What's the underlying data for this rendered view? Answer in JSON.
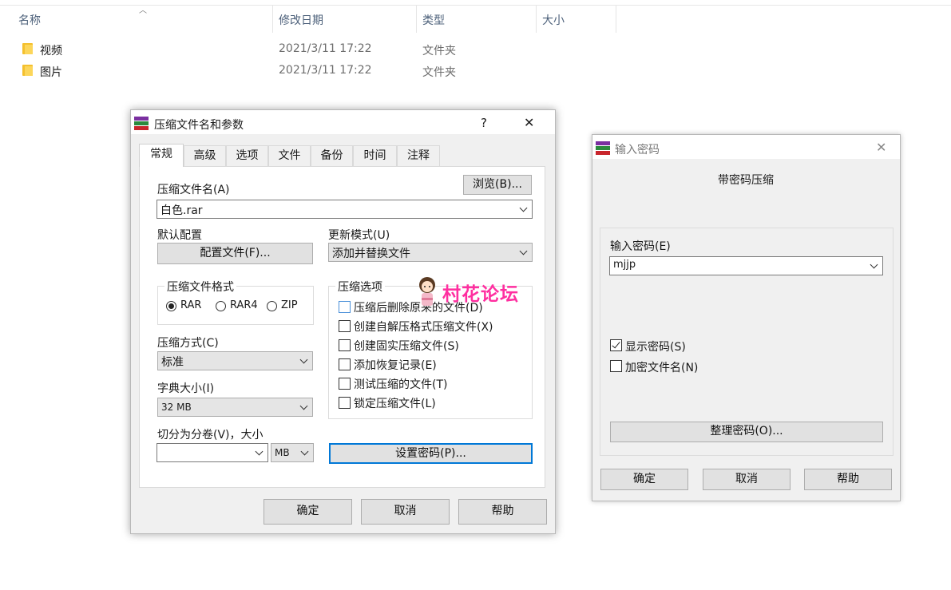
{
  "explorer": {
    "columns": {
      "name": "名称",
      "modified": "修改日期",
      "type": "类型",
      "size": "大小"
    },
    "rows": [
      {
        "name": "视频",
        "modified": "2021/3/11 17:22",
        "type": "文件夹"
      },
      {
        "name": "图片",
        "modified": "2021/3/11 17:22",
        "type": "文件夹"
      }
    ]
  },
  "archive_dialog": {
    "title": "压缩文件名和参数",
    "help_glyph": "?",
    "close_glyph": "✕",
    "tabs": [
      "常规",
      "高级",
      "选项",
      "文件",
      "备份",
      "时间",
      "注释"
    ],
    "archive_name_label": "压缩文件名(A)",
    "browse_button": "浏览(B)...",
    "archive_name_value": "白色.rar",
    "default_profile_label": "默认配置",
    "profiles_button": "配置文件(F)...",
    "update_mode_label": "更新模式(U)",
    "update_mode_value": "添加并替换文件",
    "format_group": "压缩文件格式",
    "formats": [
      "RAR",
      "RAR4",
      "ZIP"
    ],
    "selected_format": "RAR",
    "method_label": "压缩方式(C)",
    "method_value": "标准",
    "dict_label": "字典大小(I)",
    "dict_value": "32 MB",
    "split_label": "切分为分卷(V)，大小",
    "split_value": "",
    "split_unit": "MB",
    "options_group": "压缩选项",
    "options": [
      {
        "label": "压缩后删除原来的文件(D)",
        "checked": false
      },
      {
        "label": "创建自解压格式压缩文件(X)",
        "checked": false
      },
      {
        "label": "创建固实压缩文件(S)",
        "checked": false
      },
      {
        "label": "添加恢复记录(E)",
        "checked": false
      },
      {
        "label": "测试压缩的文件(T)",
        "checked": false
      },
      {
        "label": "锁定压缩文件(L)",
        "checked": false
      }
    ],
    "set_password_button": "设置密码(P)...",
    "ok_button": "确定",
    "cancel_button": "取消",
    "help_button": "帮助"
  },
  "watermark": {
    "text": "村花论坛"
  },
  "password_dialog": {
    "title": "输入密码",
    "close_glyph": "✕",
    "heading": "带密码压缩",
    "password_label": "输入密码(E)",
    "password_value": "mjjp",
    "show_password": {
      "label": "显示密码(S)",
      "checked": true
    },
    "encrypt_names": {
      "label": "加密文件名(N)",
      "checked": false
    },
    "organize_button": "整理密码(O)...",
    "ok_button": "确定",
    "cancel_button": "取消",
    "help_button": "帮助"
  },
  "colors": {
    "accent": "#0078d7",
    "watermark": "#ff2fa0",
    "dialog_bg": "#f0f0f0"
  }
}
